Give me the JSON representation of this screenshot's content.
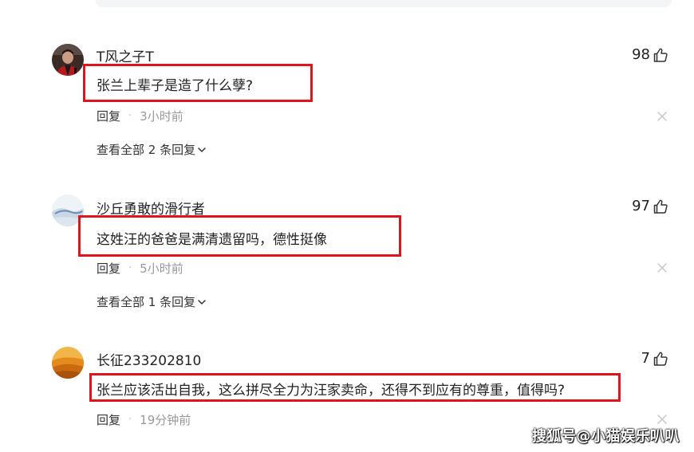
{
  "comments": [
    {
      "username": "T风之子T",
      "likes": "98",
      "text": "张兰上辈子是造了什么孽?",
      "reply_label": "回复",
      "separator": "·",
      "time": "3小时前",
      "view_all": "查看全部 2 条回复",
      "avatar_icon": "portrait-photo-avatar"
    },
    {
      "username": "沙丘勇敢的滑行者",
      "likes": "97",
      "text": "这姓汪的爸爸是满清遗留吗，德性挺像",
      "reply_label": "回复",
      "separator": "·",
      "time": "5小时前",
      "view_all": "查看全部 1 条回复",
      "avatar_icon": "landscape-avatar"
    },
    {
      "username": "长征233202810",
      "likes": "7",
      "text": "张兰应该活出自我，这么拼尽全力为汪家卖命，还得不到应有的尊重，值得吗?",
      "reply_label": "回复",
      "separator": "·",
      "time": "19分钟前",
      "avatar_icon": "desert-dunes-avatar"
    }
  ],
  "watermark": "搜狐号@小猫娱乐叭叭",
  "colors": {
    "highlight_border": "#e0141b",
    "meta_text": "#999999",
    "close_icon": "#c7c7c7"
  }
}
